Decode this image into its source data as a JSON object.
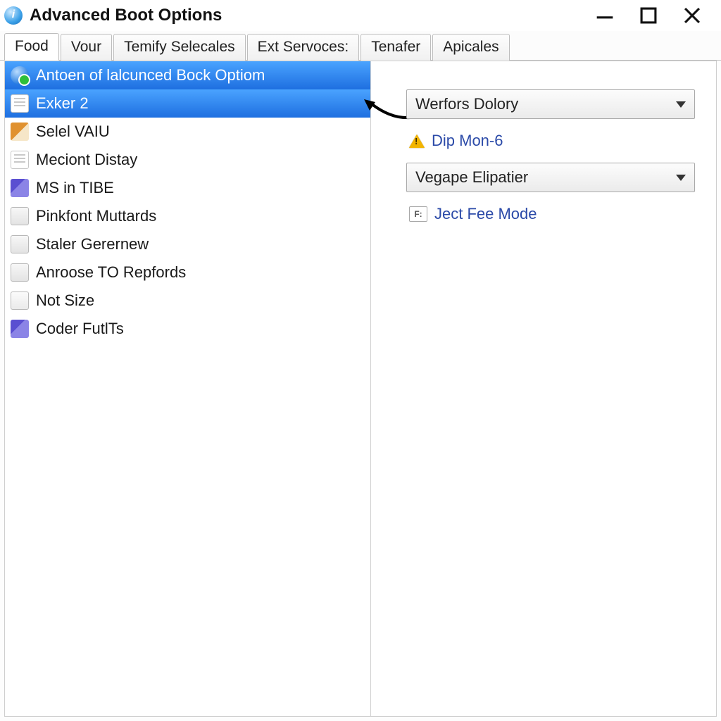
{
  "window": {
    "title": "Advanced Boot Options"
  },
  "tabs": [
    {
      "label": "Food",
      "active": true
    },
    {
      "label": "Vour"
    },
    {
      "label": "Temify Selecales"
    },
    {
      "label": "Ext Servoces:"
    },
    {
      "label": "Tenafer"
    },
    {
      "label": "Apicales"
    }
  ],
  "list": [
    {
      "label": "Antoen of lalcunced Bock Optiom",
      "icon": "globe",
      "selected": true
    },
    {
      "label": "Exker 2",
      "icon": "doc",
      "selected": true
    },
    {
      "label": "Selel VAIU",
      "icon": "img"
    },
    {
      "label": "Meciont Distay",
      "icon": "doc"
    },
    {
      "label": "MS in TIBE",
      "icon": "pen"
    },
    {
      "label": "Pinkfont Muttards",
      "icon": "folder"
    },
    {
      "label": "Staler Gerernew",
      "icon": "folder"
    },
    {
      "label": "Anroose TO Repfords",
      "icon": "folder"
    },
    {
      "label": "Not Size",
      "icon": "size"
    },
    {
      "label": "Coder FutlTs",
      "icon": "pen"
    }
  ],
  "right": {
    "dropdown1": "Werfors Dolory",
    "warn_link": "Dip Mon-6",
    "dropdown2": "Vegape Elipatier",
    "keyhint": "F:",
    "mode_link": "Ject Fee Mode"
  }
}
